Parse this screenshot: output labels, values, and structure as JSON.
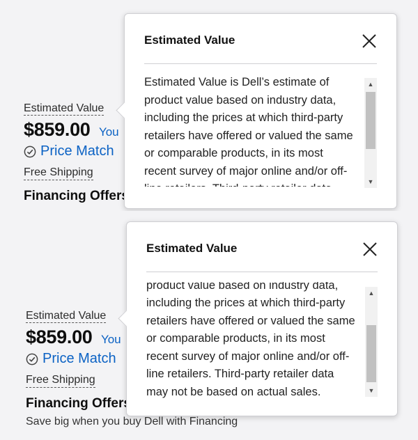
{
  "product": {
    "estimated_value_label": "Estimated Value",
    "price": "$859.00",
    "you_save_partial": "You",
    "price_match": "Price Match",
    "free_shipping": "Free Shipping",
    "financing_offers": "Financing Offers",
    "financing_sub_partial": "Save big when you buy Dell with Financing"
  },
  "popover": {
    "title": "Estimated Value",
    "close_icon": "close-x-icon",
    "body_text": "Estimated Value is Dell’s estimate of product value based on industry data, including the prices at which third-party retailers have offered or valued the same or comparable products, in its most recent survey of major online and/or off-line retailers. Third-party retailer data may not be based on actual sales.",
    "top_scroll_progress": 0.0,
    "bottom_scroll_progress": 1.0
  },
  "colors": {
    "link_blue": "#0b62c4",
    "page_bg": "#f3f3f5",
    "popover_bg": "#ffffff",
    "scroll_thumb": "#c1c1c1"
  },
  "icons": {
    "price_match": "check-circle-icon",
    "scroll_up": "scroll-up-arrow-icon",
    "scroll_down": "scroll-down-arrow-icon"
  }
}
